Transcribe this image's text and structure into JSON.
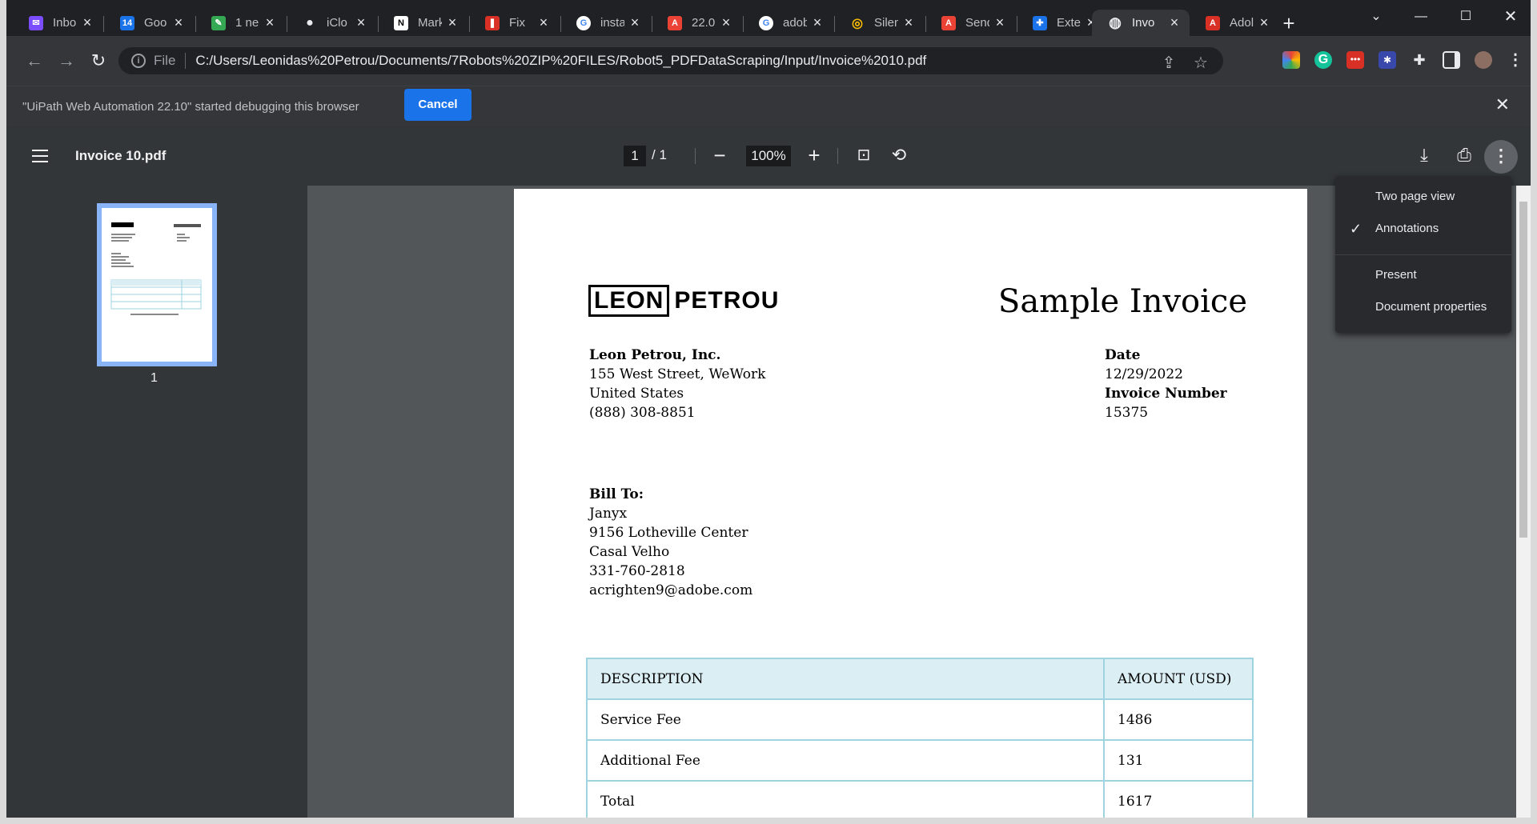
{
  "tabs": [
    {
      "title": "Inbo",
      "icon": "inbox-icon",
      "color": "#7c4dff",
      "glyph": "✉"
    },
    {
      "title": "Goo",
      "icon": "calendar-icon",
      "color": "#1a73e8",
      "glyph": "14"
    },
    {
      "title": "1 ne",
      "icon": "sheet-icon",
      "color": "#34a853",
      "glyph": "✎"
    },
    {
      "title": "iClo",
      "icon": "apple-icon",
      "color": "#9aa0a6",
      "glyph": ""
    },
    {
      "title": "Mark",
      "icon": "notion-icon",
      "color": "#ffffff",
      "glyph": "N"
    },
    {
      "title": "Fix",
      "icon": "pdf-tool-icon",
      "color": "#d93025",
      "glyph": "❚"
    },
    {
      "title": "insta",
      "icon": "google-icon",
      "color": "#ffffff",
      "glyph": "G"
    },
    {
      "title": "22.0",
      "icon": "adobe-icon",
      "color": "#ea4335",
      "glyph": "A"
    },
    {
      "title": "adob",
      "icon": "google-icon",
      "color": "#ffffff",
      "glyph": "G"
    },
    {
      "title": "Silen",
      "icon": "spiral-icon",
      "color": "#fbbc04",
      "glyph": "◎"
    },
    {
      "title": "Send",
      "icon": "adobe-icon",
      "color": "#ea4335",
      "glyph": "A"
    },
    {
      "title": "Exte",
      "icon": "puzzle-icon",
      "color": "#1a73e8",
      "glyph": "✚"
    },
    {
      "title": "Invo",
      "icon": "globe-icon",
      "color": "#e8eaed",
      "glyph": "◍"
    },
    {
      "title": "Adol",
      "icon": "acrobat-icon",
      "color": "#d93025",
      "glyph": "A"
    }
  ],
  "address": {
    "scheme": "File",
    "url": "C:/Users/Leonidas%20Petrou/Documents/7Robots%20ZIP%20FILES/Robot5_PDFDataScraping/Input/Invoice%2010.pdf"
  },
  "infobar": {
    "message": "\"UiPath Web Automation 22.10\" started debugging this browser",
    "cancel_label": "Cancel"
  },
  "pdf": {
    "filename": "Invoice 10.pdf",
    "current_page": "1",
    "total_pages": "/  1",
    "zoom": "100%",
    "thumb_label": "1"
  },
  "menu": {
    "items": [
      "Two page view",
      "Annotations",
      "Present",
      "Document properties"
    ]
  },
  "invoice": {
    "logo_boxed": "LEON",
    "logo_plain": "PETROU",
    "title": "Sample Invoice",
    "company": [
      "Leon Petrou, Inc.",
      "155 West Street, WeWork",
      "United States",
      "(888) 308-8851"
    ],
    "date_label": "Date",
    "date_value": "12/29/2022",
    "number_label": "Invoice Number",
    "number_value": "15375",
    "bill_to_label": "Bill To:",
    "bill_to": [
      "Janyx",
      "9156 Lotheville Center",
      "Casal Velho",
      "331-760-2818",
      "acrighten9@adobe.com"
    ],
    "table": {
      "headers": [
        "DESCRIPTION",
        "AMOUNT (USD)"
      ],
      "rows": [
        [
          "Service Fee",
          "1486"
        ],
        [
          "Additional Fee",
          "131"
        ],
        [
          "Total",
          "1617"
        ]
      ]
    }
  }
}
